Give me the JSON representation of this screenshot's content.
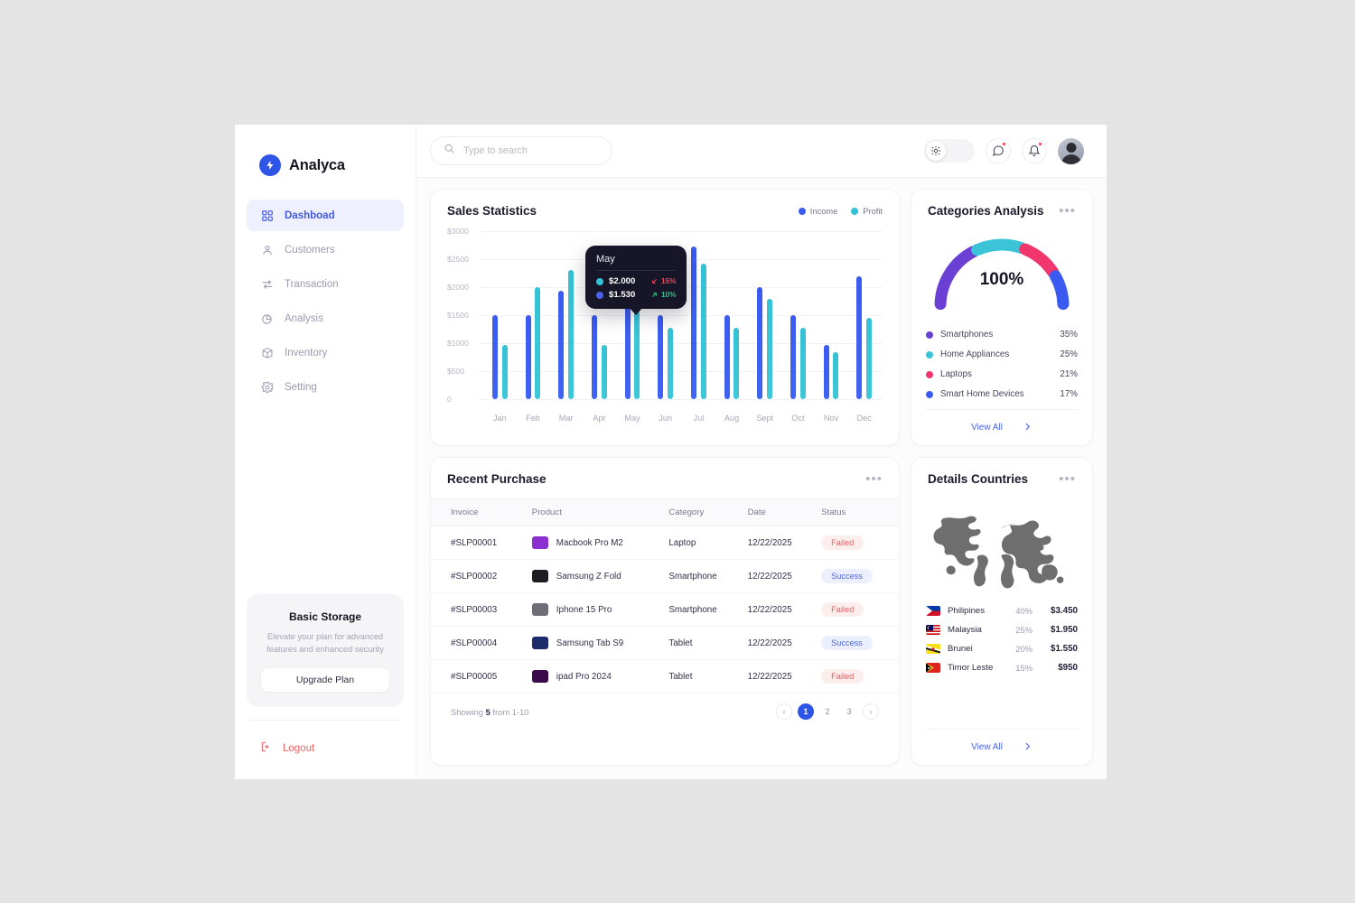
{
  "brand": {
    "name": "Analyca",
    "mark_icon": "bolt-icon"
  },
  "sidebar": {
    "items": [
      {
        "label": "Dashboad",
        "icon": "grid-icon",
        "active": true
      },
      {
        "label": "Customers",
        "icon": "user-icon",
        "active": false
      },
      {
        "label": "Transaction",
        "icon": "transfer-icon",
        "active": false
      },
      {
        "label": "Analysis",
        "icon": "pie-chart-icon",
        "active": false
      },
      {
        "label": "Inventory",
        "icon": "box-icon",
        "active": false
      },
      {
        "label": "Setting",
        "icon": "gear-icon",
        "active": false
      }
    ],
    "promo": {
      "title": "Basic Storage",
      "description": "Elevate your plan for advanced features and enhanced security",
      "button_label": "Upgrade Plan"
    },
    "logout_label": "Logout",
    "logout_icon": "logout-icon"
  },
  "topbar": {
    "search_placeholder": "Type to search",
    "search_value": "",
    "search_icon": "search-icon",
    "theme_toggle_icon": "sun-icon",
    "messages_icon": "chat-icon",
    "notifications_icon": "bell-icon",
    "avatar_name": "avatar"
  },
  "sales": {
    "title": "Sales Statistics",
    "legend": [
      {
        "label": "Income",
        "color": "#3b5bf0"
      },
      {
        "label": "Profit",
        "color": "#35c1d6"
      }
    ],
    "tooltip": {
      "month": "May",
      "rows": [
        {
          "value": "$2.000",
          "delta": "15%",
          "direction": "down",
          "color": "#35c1d6",
          "delta_color": "#f0455a"
        },
        {
          "value": "$1.530",
          "delta": "10%",
          "direction": "up",
          "color": "#4a63e8",
          "delta_color": "#2bc48a"
        }
      ]
    }
  },
  "chart_data": {
    "type": "bar",
    "title": "Sales Statistics",
    "xlabel": "",
    "ylabel": "",
    "ylim": [
      0,
      3000
    ],
    "ytick_labels": [
      "$3000",
      "$2500",
      "$2000",
      "$1500",
      "$1000",
      "$500",
      "0"
    ],
    "yticks": [
      3000,
      2500,
      2000,
      1500,
      1000,
      500,
      0
    ],
    "grid": true,
    "legend_position": "top-right",
    "categories": [
      "Jan",
      "Feb",
      "Mar",
      "Apr",
      "May",
      "Jun",
      "Jul",
      "Aug",
      "Sept",
      "Oct",
      "Nov",
      "Dec"
    ],
    "series": [
      {
        "name": "Income",
        "color": "#3b5bf0",
        "values": [
          1500,
          1500,
          1930,
          1500,
          1800,
          1500,
          2720,
          1500,
          2000,
          1500,
          970,
          2200
        ]
      },
      {
        "name": "Profit",
        "color": "#35c1d6",
        "values": [
          970,
          2000,
          2300,
          970,
          2000,
          1280,
          2420,
          1280,
          1790,
          1280,
          840,
          1450
        ]
      }
    ],
    "annotations": [
      {
        "type": "tooltip",
        "category": "May",
        "profit": 2000,
        "income": 1530,
        "profit_delta": "-15%",
        "income_delta": "+10%"
      }
    ]
  },
  "categories": {
    "title": "Categories Analysis",
    "menu_icon": "more-icon",
    "center_label": "100%",
    "gauge": {
      "type": "semi-donut",
      "segments": [
        {
          "label": "Smartphones",
          "percent": 35,
          "color": "#6b3fd4"
        },
        {
          "label": "Home Appliances",
          "percent": 25,
          "color": "#3bc4d8"
        },
        {
          "label": "Laptops",
          "percent": 21,
          "color": "#f0366d"
        },
        {
          "label": "Smart Home Devices",
          "percent": 17,
          "color": "#3b5bf0"
        }
      ]
    },
    "items": [
      {
        "label": "Smartphones",
        "percent": "35%",
        "color": "#6b3fd4"
      },
      {
        "label": "Home Appliances",
        "percent": "25%",
        "color": "#3bc4d8"
      },
      {
        "label": "Laptops",
        "percent": "21%",
        "color": "#f0366d"
      },
      {
        "label": "Smart Home Devices",
        "percent": "17%",
        "color": "#3b5bf0"
      }
    ],
    "view_all_label": "View All",
    "view_all_icon": "chevron-right-icon"
  },
  "purchases": {
    "title": "Recent Purchase",
    "menu_icon": "more-icon",
    "columns": [
      "Invoice",
      "Product",
      "Category",
      "Date",
      "Status"
    ],
    "rows": [
      {
        "invoice": "#SLP00001",
        "product": "Macbook Pro M2",
        "category": "Laptop",
        "date": "12/22/2025",
        "status": "Failed",
        "thumb": "#8b2fd0"
      },
      {
        "invoice": "#SLP00002",
        "product": "Samsung Z Fold",
        "category": "Smartphone",
        "date": "12/22/2025",
        "status": "Success",
        "thumb": "#1c1c22"
      },
      {
        "invoice": "#SLP00003",
        "product": "Iphone 15 Pro",
        "category": "Smartphone",
        "date": "12/22/2025",
        "status": "Failed",
        "thumb": "#6e6e78"
      },
      {
        "invoice": "#SLP00004",
        "product": "Samsung Tab S9",
        "category": "Tablet",
        "date": "12/22/2025",
        "status": "Success",
        "thumb": "#1d2b6b"
      },
      {
        "invoice": "#SLP00005",
        "product": "ipad Pro 2024",
        "category": "Tablet",
        "date": "12/22/2025",
        "status": "Failed",
        "thumb": "#3a0a4a"
      }
    ],
    "footer_text": "Showing 5 from 1-10",
    "footer_prefix": "Showing ",
    "footer_count": "5",
    "footer_suffix": " from 1-10",
    "pagination": {
      "prev_icon": "chevron-left-icon",
      "next_icon": "chevron-right-icon",
      "pages": [
        "1",
        "2",
        "3"
      ],
      "active_page": "1"
    }
  },
  "countries": {
    "title": "Details Countries",
    "menu_icon": "more-icon",
    "map_icon": "world-map",
    "rows": [
      {
        "name": "Philipines",
        "percent": "40%",
        "amount": "$3.450",
        "flag": "philippines-flag"
      },
      {
        "name": "Malaysia",
        "percent": "25%",
        "amount": "$1.950",
        "flag": "malaysia-flag"
      },
      {
        "name": "Brunei",
        "percent": "20%",
        "amount": "$1.550",
        "flag": "brunei-flag"
      },
      {
        "name": "Timor Leste",
        "percent": "15%",
        "amount": "$950",
        "flag": "timor-leste-flag"
      }
    ],
    "view_all_label": "View All",
    "view_all_icon": "chevron-right-icon"
  },
  "colors": {
    "accent": "#2f55e8",
    "income": "#3b5bf0",
    "profit": "#35c1d6",
    "danger": "#ea5a5a",
    "success_pill_bg": "#eceffd"
  }
}
